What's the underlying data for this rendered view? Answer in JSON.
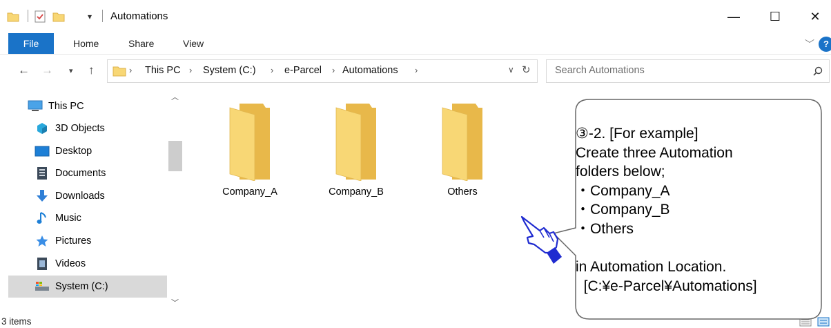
{
  "window": {
    "title": "Automations",
    "controls": {
      "minimize": "—",
      "maximize": "☐",
      "close": "✕"
    }
  },
  "ribbon": {
    "tabs": [
      "File",
      "Home",
      "Share",
      "View"
    ],
    "help": "?"
  },
  "address": {
    "crumbs": [
      "This PC",
      "System (C:)",
      "e-Parcel",
      "Automations"
    ],
    "search_placeholder": "Search Automations"
  },
  "nav": {
    "items": [
      {
        "label": "This PC",
        "icon": "this-pc-icon"
      },
      {
        "label": "3D Objects",
        "icon": "3d-objects-icon"
      },
      {
        "label": "Desktop",
        "icon": "desktop-icon"
      },
      {
        "label": "Documents",
        "icon": "documents-icon"
      },
      {
        "label": "Downloads",
        "icon": "downloads-icon"
      },
      {
        "label": "Music",
        "icon": "music-icon"
      },
      {
        "label": "Pictures",
        "icon": "pictures-icon"
      },
      {
        "label": "Videos",
        "icon": "videos-icon"
      },
      {
        "label": "System (C:)",
        "icon": "drive-icon",
        "selected": true
      }
    ]
  },
  "folders": [
    "Company_A",
    "Company_B",
    "Others"
  ],
  "status": {
    "items": "3 items"
  },
  "callout": {
    "lines": [
      "③-2. [For example]",
      "Create three Automation",
      "folders below;",
      "・Company_A",
      "・Company_B",
      "・Others",
      "",
      "in Automation Location.",
      "  [C:¥e-Parcel¥Automations]"
    ]
  },
  "colors": {
    "accent": "#1a73c8",
    "folder": "#f8d775",
    "selection": "#d9d9d9"
  }
}
